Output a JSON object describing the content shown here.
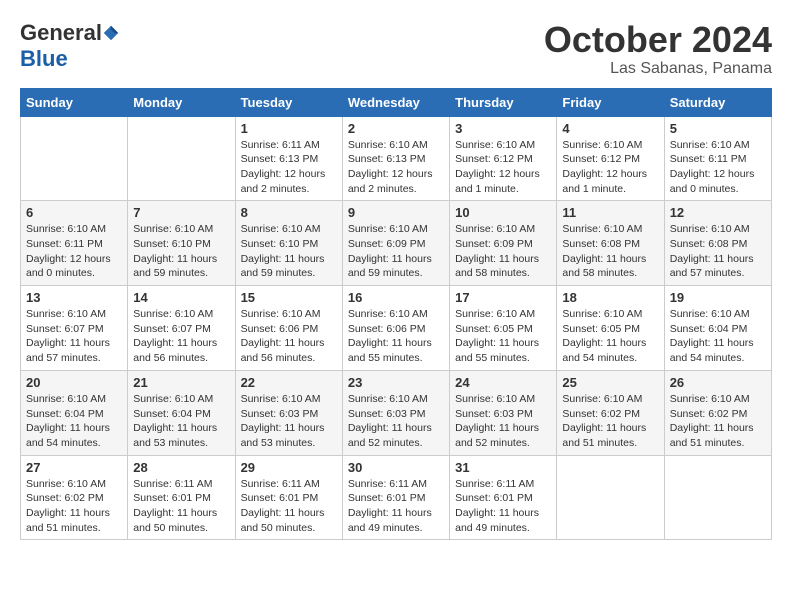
{
  "logo": {
    "general": "General",
    "blue": "Blue"
  },
  "title": "October 2024",
  "subtitle": "Las Sabanas, Panama",
  "days_header": [
    "Sunday",
    "Monday",
    "Tuesday",
    "Wednesday",
    "Thursday",
    "Friday",
    "Saturday"
  ],
  "weeks": [
    [
      {
        "day": "",
        "info": ""
      },
      {
        "day": "",
        "info": ""
      },
      {
        "day": "1",
        "info": "Sunrise: 6:11 AM\nSunset: 6:13 PM\nDaylight: 12 hours\nand 2 minutes."
      },
      {
        "day": "2",
        "info": "Sunrise: 6:10 AM\nSunset: 6:13 PM\nDaylight: 12 hours\nand 2 minutes."
      },
      {
        "day": "3",
        "info": "Sunrise: 6:10 AM\nSunset: 6:12 PM\nDaylight: 12 hours\nand 1 minute."
      },
      {
        "day": "4",
        "info": "Sunrise: 6:10 AM\nSunset: 6:12 PM\nDaylight: 12 hours\nand 1 minute."
      },
      {
        "day": "5",
        "info": "Sunrise: 6:10 AM\nSunset: 6:11 PM\nDaylight: 12 hours\nand 0 minutes."
      }
    ],
    [
      {
        "day": "6",
        "info": "Sunrise: 6:10 AM\nSunset: 6:11 PM\nDaylight: 12 hours\nand 0 minutes."
      },
      {
        "day": "7",
        "info": "Sunrise: 6:10 AM\nSunset: 6:10 PM\nDaylight: 11 hours\nand 59 minutes."
      },
      {
        "day": "8",
        "info": "Sunrise: 6:10 AM\nSunset: 6:10 PM\nDaylight: 11 hours\nand 59 minutes."
      },
      {
        "day": "9",
        "info": "Sunrise: 6:10 AM\nSunset: 6:09 PM\nDaylight: 11 hours\nand 59 minutes."
      },
      {
        "day": "10",
        "info": "Sunrise: 6:10 AM\nSunset: 6:09 PM\nDaylight: 11 hours\nand 58 minutes."
      },
      {
        "day": "11",
        "info": "Sunrise: 6:10 AM\nSunset: 6:08 PM\nDaylight: 11 hours\nand 58 minutes."
      },
      {
        "day": "12",
        "info": "Sunrise: 6:10 AM\nSunset: 6:08 PM\nDaylight: 11 hours\nand 57 minutes."
      }
    ],
    [
      {
        "day": "13",
        "info": "Sunrise: 6:10 AM\nSunset: 6:07 PM\nDaylight: 11 hours\nand 57 minutes."
      },
      {
        "day": "14",
        "info": "Sunrise: 6:10 AM\nSunset: 6:07 PM\nDaylight: 11 hours\nand 56 minutes."
      },
      {
        "day": "15",
        "info": "Sunrise: 6:10 AM\nSunset: 6:06 PM\nDaylight: 11 hours\nand 56 minutes."
      },
      {
        "day": "16",
        "info": "Sunrise: 6:10 AM\nSunset: 6:06 PM\nDaylight: 11 hours\nand 55 minutes."
      },
      {
        "day": "17",
        "info": "Sunrise: 6:10 AM\nSunset: 6:05 PM\nDaylight: 11 hours\nand 55 minutes."
      },
      {
        "day": "18",
        "info": "Sunrise: 6:10 AM\nSunset: 6:05 PM\nDaylight: 11 hours\nand 54 minutes."
      },
      {
        "day": "19",
        "info": "Sunrise: 6:10 AM\nSunset: 6:04 PM\nDaylight: 11 hours\nand 54 minutes."
      }
    ],
    [
      {
        "day": "20",
        "info": "Sunrise: 6:10 AM\nSunset: 6:04 PM\nDaylight: 11 hours\nand 54 minutes."
      },
      {
        "day": "21",
        "info": "Sunrise: 6:10 AM\nSunset: 6:04 PM\nDaylight: 11 hours\nand 53 minutes."
      },
      {
        "day": "22",
        "info": "Sunrise: 6:10 AM\nSunset: 6:03 PM\nDaylight: 11 hours\nand 53 minutes."
      },
      {
        "day": "23",
        "info": "Sunrise: 6:10 AM\nSunset: 6:03 PM\nDaylight: 11 hours\nand 52 minutes."
      },
      {
        "day": "24",
        "info": "Sunrise: 6:10 AM\nSunset: 6:03 PM\nDaylight: 11 hours\nand 52 minutes."
      },
      {
        "day": "25",
        "info": "Sunrise: 6:10 AM\nSunset: 6:02 PM\nDaylight: 11 hours\nand 51 minutes."
      },
      {
        "day": "26",
        "info": "Sunrise: 6:10 AM\nSunset: 6:02 PM\nDaylight: 11 hours\nand 51 minutes."
      }
    ],
    [
      {
        "day": "27",
        "info": "Sunrise: 6:10 AM\nSunset: 6:02 PM\nDaylight: 11 hours\nand 51 minutes."
      },
      {
        "day": "28",
        "info": "Sunrise: 6:11 AM\nSunset: 6:01 PM\nDaylight: 11 hours\nand 50 minutes."
      },
      {
        "day": "29",
        "info": "Sunrise: 6:11 AM\nSunset: 6:01 PM\nDaylight: 11 hours\nand 50 minutes."
      },
      {
        "day": "30",
        "info": "Sunrise: 6:11 AM\nSunset: 6:01 PM\nDaylight: 11 hours\nand 49 minutes."
      },
      {
        "day": "31",
        "info": "Sunrise: 6:11 AM\nSunset: 6:01 PM\nDaylight: 11 hours\nand 49 minutes."
      },
      {
        "day": "",
        "info": ""
      },
      {
        "day": "",
        "info": ""
      }
    ]
  ]
}
